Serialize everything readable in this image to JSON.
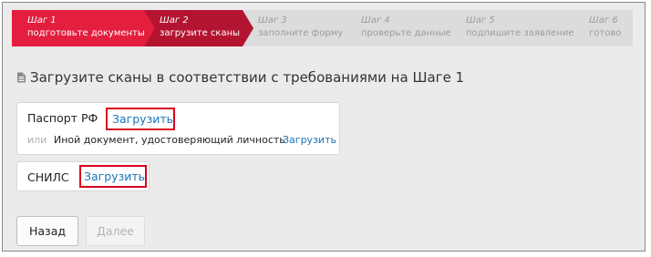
{
  "steps": [
    {
      "num": "Шаг 1",
      "text": "подготовьте документы",
      "state": "done"
    },
    {
      "num": "Шаг 2",
      "text": "загрузите сканы",
      "state": "current"
    },
    {
      "num": "Шаг 3",
      "text": "заполните форму",
      "state": "todo"
    },
    {
      "num": "Шаг 4",
      "text": "проверьте данные",
      "state": "todo"
    },
    {
      "num": "Шаг 5",
      "text": "подпишите заявление",
      "state": "todo"
    },
    {
      "num": "Шаг 6",
      "text": "готово",
      "state": "todo"
    }
  ],
  "colors": {
    "step_done": "#e31e3e",
    "step_current": "#b31530",
    "step_todo": "#dcdcdc",
    "link": "#1a74b8",
    "highlight": "#d7001f"
  },
  "heading": "Загрузите сканы в соответствии с требованиями на Шаге 1",
  "passport": {
    "label": "Паспорт РФ",
    "upload": "Загрузить",
    "or": "или",
    "alt_label": "Иной документ, удостоверяющий личность",
    "alt_upload": "Загрузить"
  },
  "snils": {
    "label": "СНИЛС",
    "upload": "Загрузить"
  },
  "buttons": {
    "back": "Назад",
    "next": "Далее"
  },
  "icons": {
    "heading": "document-icon"
  }
}
